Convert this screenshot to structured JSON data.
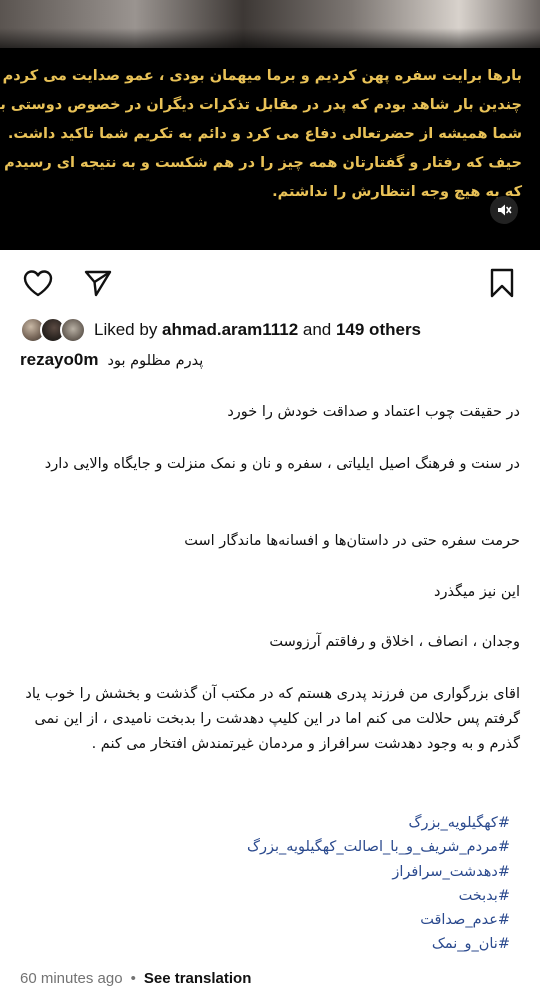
{
  "video": {
    "subtitle_lines": [
      "بارها برایت سفره پهن کردیم و برما میهمان بودی ، عمو صدایت  می کردم",
      "چندین بار شاهد بودم که پدر در مقابل تذکرات دیگران  در خصوص دوستی با",
      "شما  همیشه از حضرتعالی  دفاع می کرد و  دائم به تکریم شما تاکید داشت.",
      "حیف که رفتار و گفتارتان همه چیز را در هم شکست و به نتیجه ای رسیدم",
      "که به هیچ وجه انتظارش را نداشتم."
    ],
    "mute_icon": "speaker-muted-icon"
  },
  "actions": {
    "like_icon": "heart-icon",
    "share_icon": "send-icon",
    "save_icon": "bookmark-icon"
  },
  "likes": {
    "prefix": "Liked by ",
    "user": "ahmad.aram1112",
    "middle": " and ",
    "others": "149 others"
  },
  "caption": {
    "username": "rezayo0m",
    "first_line": "پدرم مظلوم بود",
    "paragraphs": [
      "در حقیقت چوب اعتماد و صداقت خودش را خورد",
      "در سنت و فرهنگ اصیل ایلیاتی ، سفره و نان و نمک منزلت و جایگاه والایی دارد",
      "حرمت سفره حتی در داستان‌ها و افسانه‌ها ماندگار است",
      "این نیز میگذرد",
      "وجدان ، انصاف ، اخلاق و رفاقتم آرزوست",
      "اقای بزرگواری من فرزند پدری هستم که در مکتب آن گذشت و بخشش را خوب یاد گرفتم پس حلالت می کنم اما در این کلیپ دهدشت را بدبخت نامیدی ، از این نمی گذرم و به وجود دهدشت سرافراز و مردمان غیرتمندش افتخار می کنم ."
    ],
    "hashtags": [
      "#کهگیلویه_بزرگ",
      "#مردم_شریف_و_با_اصالت_کهگیلویه_بزرگ",
      "#دهدشت_سرافراز",
      "#بدبخت",
      "#عدم_صداقت",
      "#نان_و_نمک"
    ]
  },
  "footer": {
    "time": "60 minutes ago",
    "separator": "•",
    "translate": "See translation"
  },
  "colors": {
    "subtitle": "#e9c257",
    "hashtag": "#2b4a8e",
    "muted_text": "#737373"
  }
}
